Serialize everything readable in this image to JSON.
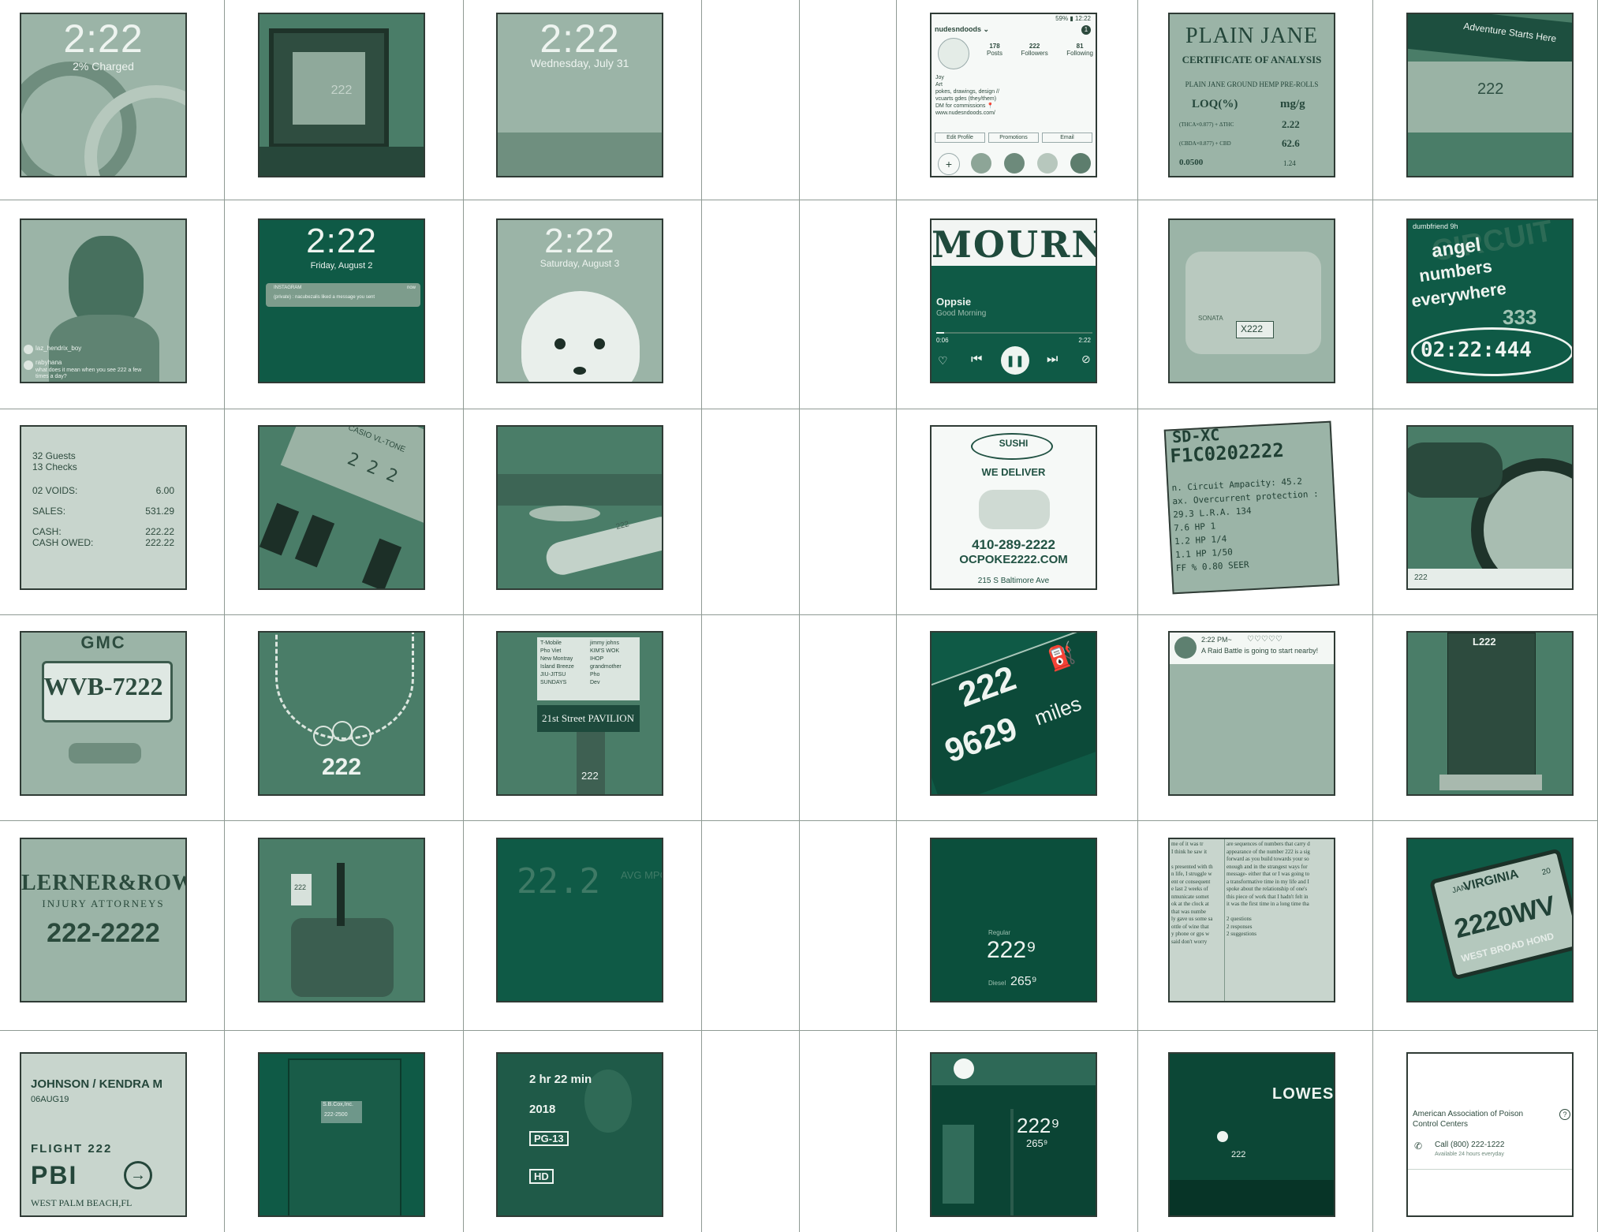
{
  "grid": {
    "r1c1": {
      "time": "2:22",
      "caption": "2% Charged"
    },
    "r1c2": {
      "frame_number": "222"
    },
    "r1c3": {
      "time": "2:22",
      "caption": "Wednesday, July 31"
    },
    "r1c6": {
      "status_bar": "59% ▮ 12:22",
      "username": "nudesndoods ⌄",
      "badge": "1",
      "stats": [
        {
          "value": "178",
          "label": "Posts"
        },
        {
          "value": "222",
          "label": "Followers"
        },
        {
          "value": "81",
          "label": "Following"
        }
      ],
      "bio": [
        "Joy",
        "Art",
        "pokes, drawings, design //",
        "vcuarts gdes (they/them)",
        "DM for commissions 📍",
        "www.nudesndoods.com/"
      ],
      "buttons": [
        "Edit Profile",
        "Promotions",
        "Email"
      ],
      "add": "+"
    },
    "r1c7": {
      "title": "PLAIN JANE",
      "subtitle": "CERTIFICATE OF ANALYSIS",
      "product": "PLAIN JANE GROUND HEMP PRE-ROLLS",
      "col_loq": "LOQ(%)",
      "col_mg": "mg/g",
      "rows": [
        [
          "(THCA×0.877) + ΔTHC",
          "2.22"
        ],
        [
          "(CBDA×0.877) + CBD",
          "62.6"
        ],
        [
          "0.0500",
          "1.24"
        ]
      ]
    },
    "r1c8": {
      "sign_text": "Adventure Starts Here",
      "number": "222"
    },
    "r2c1": {
      "comment1_user": "laz_hendrix_boy",
      "comment2_user": "rabyhana",
      "comment2_text": "what does it mean when you see 222 a few times a day?"
    },
    "r2c2": {
      "time": "2:22",
      "caption": "Friday, August 2",
      "notif_app": "INSTAGRAM",
      "notif_when": "now",
      "notif_text": "(private) : nacubezalis liked a message you sent"
    },
    "r2c3": {
      "time": "2:22",
      "caption": "Saturday, August 3"
    },
    "r2c6": {
      "banner": "MOURN",
      "track": "Oppsie",
      "artist": "Good Morning",
      "elapsed": "0:06",
      "total": "2:22"
    },
    "r2c7": {
      "brand": "SONATA",
      "plate": "X222"
    },
    "r2c8": {
      "user": "dumbfriend 9h",
      "line1": "angel",
      "line2": "numbers",
      "line3": "everywhere",
      "bg_number": "333",
      "timer": "02:22:444",
      "bg_word": "CIRCUIT"
    },
    "r3c1": {
      "guests": "32 Guests",
      "checks": "13 Checks",
      "lines": [
        [
          "02 VOIDS:",
          "6.00"
        ],
        [
          "SALES:",
          "531.29"
        ],
        [
          "CASH:",
          "222.22"
        ],
        [
          "CASH OWED:",
          "222.22"
        ]
      ]
    },
    "r3c2": {
      "brand": "CASIO VL-TONE",
      "display": "2 2 2"
    },
    "r3c3": {
      "wrist_number": "222"
    },
    "r3c6": {
      "logo": "SUSHI",
      "tagline": "WE DELIVER",
      "phone": "410-289-2222",
      "site": "OCPOKE2222.COM",
      "address": "215 S Baltimore Ave"
    },
    "r3c7": {
      "header": "SD-XC",
      "serial": "F1C0202222",
      "lines": [
        "n. Circuit Ampacity: 45.2",
        "ax. Overcurrent protection :",
        "29.3  L.R.A.  134",
        "7.6   HP     1",
        "1.2   HP    1/4",
        "1.1   HP    1/50",
        "FF %  0.80   SEER"
      ]
    },
    "r3c8": {
      "caption": "222"
    },
    "r4c1": {
      "brand": "GMC",
      "plate": "WVB-7222"
    },
    "r4c2": {
      "pendant": "222"
    },
    "r4c3": {
      "signs": [
        "T-Mobile",
        "jimmy johns",
        "Pho Viet",
        "KIM'S WOK",
        "New Montray",
        "IHOP",
        "Island Breeze",
        "grandmother",
        "JIU-JITSU",
        "Pho",
        "SUNDAYS",
        "Dev"
      ],
      "pavilion": "21st Street PAVILION",
      "address": "222"
    },
    "r4c6": {
      "range": "222",
      "miles": "9629",
      "unit": "miles"
    },
    "r4c7": {
      "time": "2:22 PM~",
      "hearts": "♡♡♡♡♡",
      "message": "A Raid Battle is going to start nearby!"
    },
    "r4c8": {
      "label": "L222"
    },
    "r5c1": {
      "firm": "LERNER&ROWE",
      "subtitle": "INJURY ATTORNEYS",
      "phone": "222-2222"
    },
    "r5c2": {
      "sign": "222"
    },
    "r5c3": {
      "reading": "22.2",
      "label": "AVG MPG"
    },
    "r5c6": {
      "label_top": "Regular",
      "price": "222⁹",
      "label_bottom": "Diesel",
      "price2": "265⁹"
    },
    "r5c7": {
      "left_lines": [
        "me of it was tr",
        "I think he saw it",
        "",
        "s presented with th",
        "n life, I struggle w",
        "ent or consequent",
        "e last 2 weeks of",
        "nmunicate somet",
        "ok at the clock at",
        "that was numbe",
        "ly gave us some sa",
        "ottle of wine that",
        "y phone or gps w",
        "said don't worry"
      ],
      "right_lines": [
        "are sequences of numbers that carry d",
        "appearance of the number 222 is a sig",
        "forward as you build towards your so",
        "enough and in the strangest ways for",
        "message- either that or I was going to",
        "a transformative time in my life and I",
        "spoke about the relationship of one's",
        "this piece of work that I hadn't felt in",
        "it was the first time in a long time tha",
        "",
        "2 questions",
        "2 responses",
        "2 suggestions"
      ]
    },
    "r5c8": {
      "state": "VIRGINIA",
      "plate": "2220WV",
      "frame": "WEST BROAD HOND",
      "tag_month": "JAN",
      "tag_year": "20"
    },
    "r6c1": {
      "name": "JOHNSON / KENDRA M",
      "date": "06AUG19",
      "flight": "FLIGHT 222",
      "code": "PBI",
      "city": "WEST PALM BEACH,FL"
    },
    "r6c2": {
      "company": "S.B.Cox,Inc.",
      "phone": "222-2500"
    },
    "r6c3": {
      "runtime": "2 hr 22 min",
      "year": "2018",
      "rating": "PG-13",
      "quality": "HD"
    },
    "r6c6": {
      "price": "222⁹",
      "price2": "265⁹"
    },
    "r6c7": {
      "sign": "LOWES",
      "price": "222"
    },
    "r6c8": {
      "name": "American Association of Poison Control Centers",
      "call": "Call (800) 222-1222",
      "hours": "Available 24 hours everyday",
      "help": "?"
    }
  }
}
